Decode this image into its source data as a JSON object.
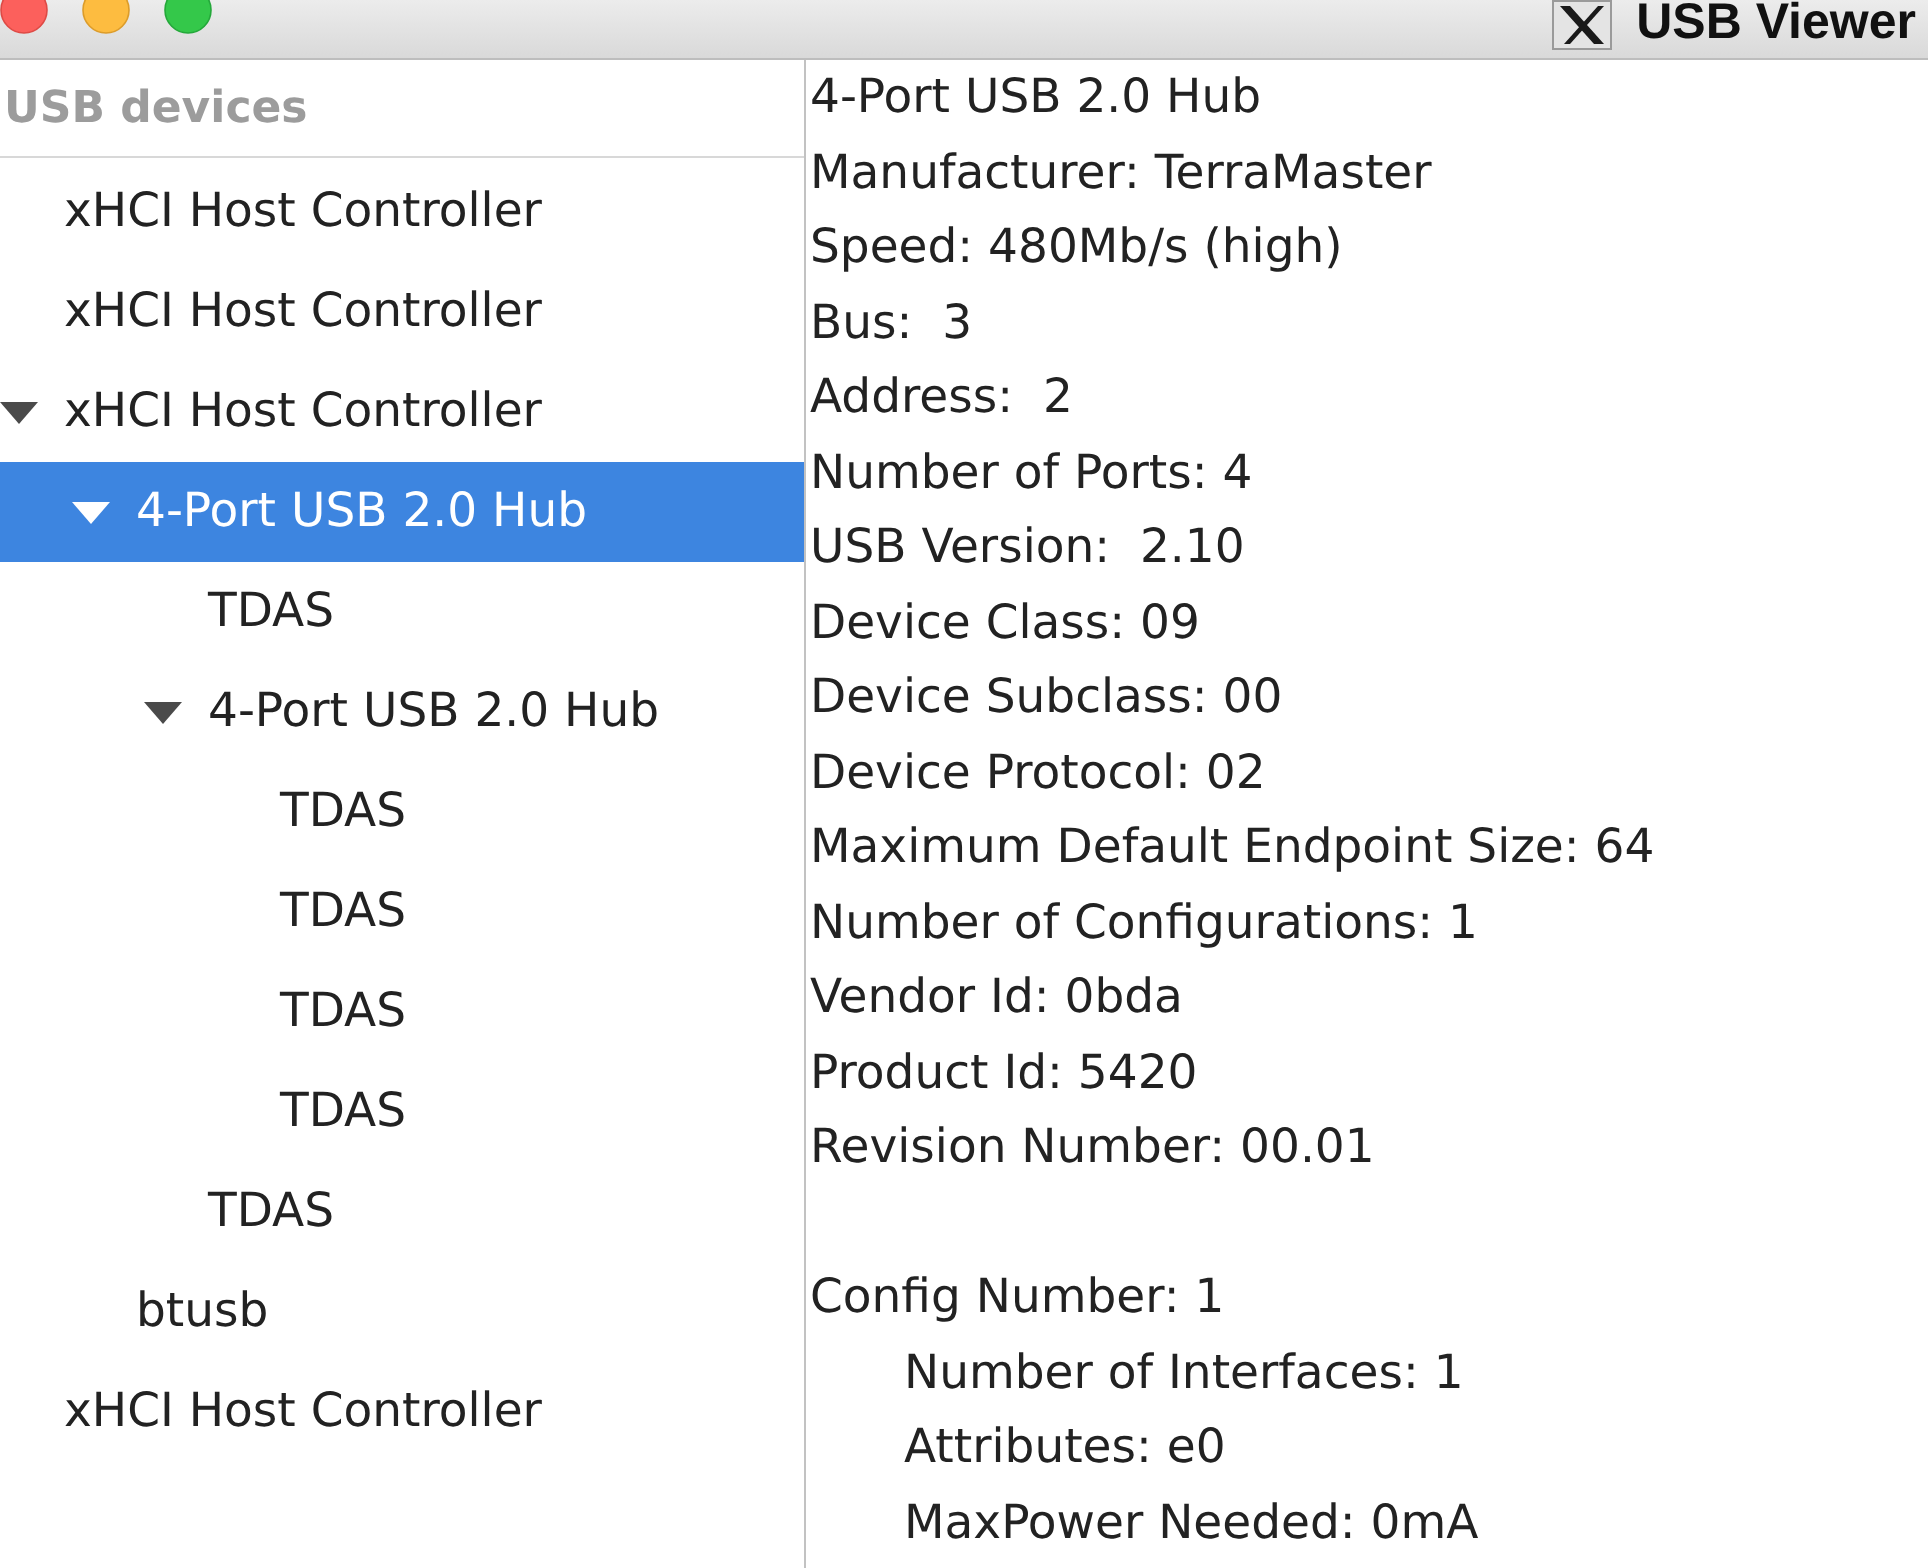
{
  "window": {
    "title": "USB Viewer"
  },
  "tree": {
    "header": "USB devices",
    "items": [
      {
        "label": "xHCI Host Controller",
        "selected": false
      },
      {
        "label": "xHCI Host Controller",
        "selected": false
      },
      {
        "label": "xHCI Host Controller",
        "selected": false,
        "expanded": true,
        "children": [
          {
            "label": "4-Port USB 2.0 Hub",
            "selected": true,
            "expanded": true,
            "children": [
              {
                "label": "TDAS",
                "selected": false
              },
              {
                "label": "4-Port USB 2.0 Hub",
                "selected": false,
                "expanded": true,
                "children": [
                  {
                    "label": "TDAS",
                    "selected": false
                  },
                  {
                    "label": "TDAS",
                    "selected": false
                  },
                  {
                    "label": "TDAS",
                    "selected": false
                  },
                  {
                    "label": "TDAS",
                    "selected": false
                  }
                ]
              },
              {
                "label": "TDAS",
                "selected": false
              }
            ]
          },
          {
            "label": "btusb",
            "selected": false
          }
        ]
      },
      {
        "label": "xHCI Host Controller",
        "selected": false
      }
    ]
  },
  "details": {
    "lines": [
      "4-Port USB 2.0 Hub",
      "Manufacturer: TerraMaster",
      "Speed: 480Mb/s (high)",
      "Bus:  3",
      "Address:  2",
      "Number of Ports: 4",
      "USB Version:  2.10",
      "Device Class: 09",
      "Device Subclass: 00",
      "Device Protocol: 02",
      "Maximum Default Endpoint Size: 64",
      "Number of Configurations: 1",
      "Vendor Id: 0bda",
      "Product Id: 5420",
      "Revision Number: 00.01"
    ],
    "configurations": [
      {
        "title": "Config Number: 1",
        "properties": [
          "Number of Interfaces: 1",
          "Attributes: e0",
          "MaxPower Needed: 0mA"
        ]
      }
    ]
  }
}
